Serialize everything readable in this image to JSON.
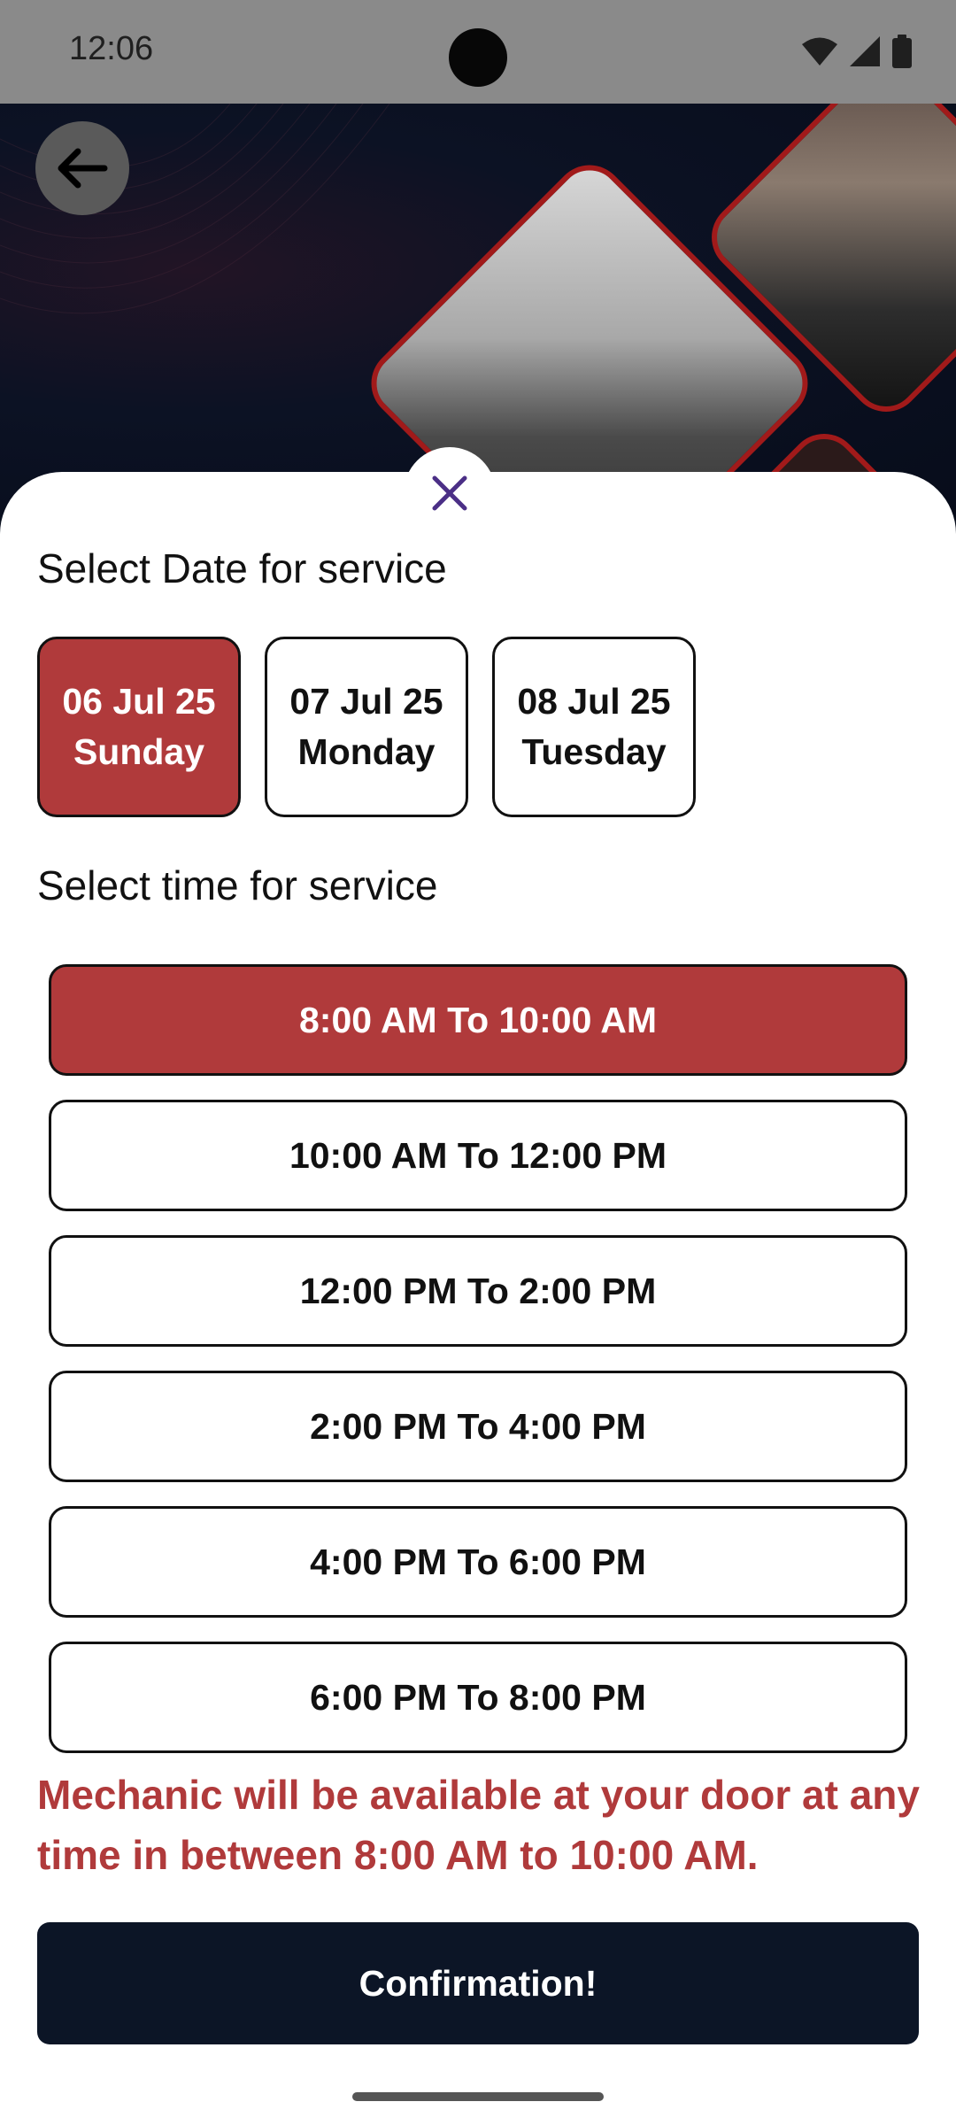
{
  "status_bar": {
    "time": "12:06"
  },
  "sheet": {
    "date_heading": "Select Date for service",
    "dates": [
      {
        "date": "06 Jul 25",
        "day": "Sunday",
        "selected": true
      },
      {
        "date": "07 Jul 25",
        "day": "Monday",
        "selected": false
      },
      {
        "date": "08 Jul 25",
        "day": "Tuesday",
        "selected": false
      }
    ],
    "time_heading": "Select time for service",
    "slots": [
      {
        "label": "8:00 AM To 10:00 AM",
        "selected": true
      },
      {
        "label": "10:00 AM To 12:00 PM",
        "selected": false
      },
      {
        "label": "12:00 PM To 2:00 PM",
        "selected": false
      },
      {
        "label": "2:00 PM To 4:00 PM",
        "selected": false
      },
      {
        "label": "4:00 PM To 6:00 PM",
        "selected": false
      },
      {
        "label": "6:00 PM To 8:00 PM",
        "selected": false
      }
    ],
    "availability_note": "Mechanic will be available at your door at any time in between 8:00 AM to 10:00 AM.",
    "confirm_label": "Confirmation!"
  },
  "colors": {
    "accent": "#b03a3b",
    "dark": "#0c1526",
    "selected_text": "#ffffff"
  },
  "icons": {
    "back": "arrow-left-icon",
    "close": "close-icon"
  }
}
